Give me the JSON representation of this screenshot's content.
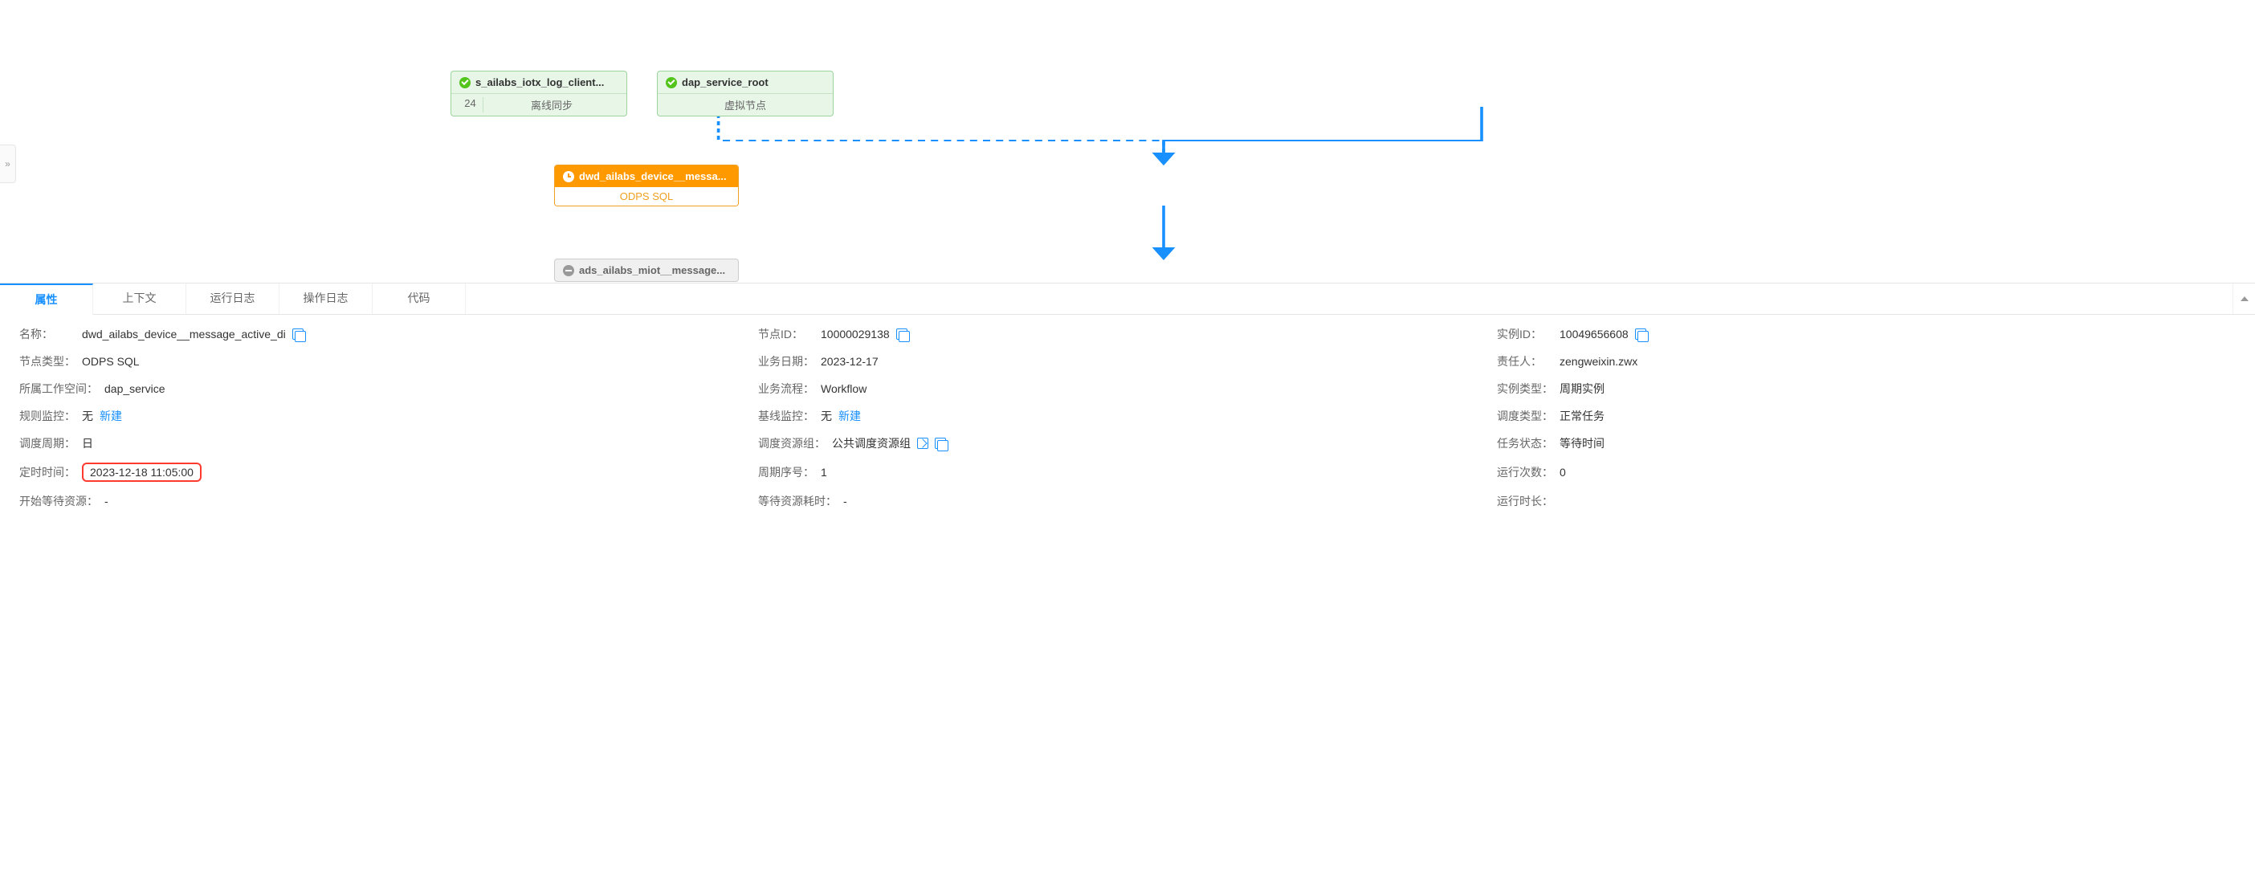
{
  "expander_glyph": "»",
  "graph": {
    "nodes": {
      "n1": {
        "title": "s_ailabs_iotx_log_client...",
        "count": "24",
        "subtype": "离线同步"
      },
      "n2": {
        "title": "dap_service_root",
        "subtype": "虚拟节点"
      },
      "n3": {
        "title": "dwd_ailabs_device__messa...",
        "subtype": "ODPS SQL"
      },
      "n4": {
        "title": "ads_ailabs_miot__message..."
      }
    }
  },
  "tabs": [
    {
      "id": "props",
      "label": "属性",
      "active": true
    },
    {
      "id": "context",
      "label": "上下文",
      "active": false
    },
    {
      "id": "runlog",
      "label": "运行日志",
      "active": false
    },
    {
      "id": "oplog",
      "label": "操作日志",
      "active": false
    },
    {
      "id": "code",
      "label": "代码",
      "active": false
    }
  ],
  "props": {
    "col1": [
      {
        "label": "名称",
        "value": "dwd_ailabs_device__message_active_di",
        "copy": true
      },
      {
        "label": "节点类型",
        "value": "ODPS SQL"
      },
      {
        "label": "所属工作空间",
        "value": "dap_service"
      },
      {
        "label": "规则监控",
        "value": "无",
        "link": "新建"
      },
      {
        "label": "调度周期",
        "value": "日"
      },
      {
        "label": "定时时间",
        "value": "2023-12-18 11:05:00",
        "highlight": true
      },
      {
        "label": "开始等待资源",
        "value": "-"
      }
    ],
    "col2": [
      {
        "label": "节点ID",
        "value": "10000029138",
        "copy": true
      },
      {
        "label": "业务日期",
        "value": "2023-12-17"
      },
      {
        "label": "业务流程",
        "value": "Workflow"
      },
      {
        "label": "基线监控",
        "value": "无",
        "link": "新建"
      },
      {
        "label": "调度资源组",
        "value": "公共调度资源组",
        "edit": true,
        "copy": true
      },
      {
        "label": "周期序号",
        "value": "1"
      },
      {
        "label": "等待资源耗时",
        "value": "-"
      }
    ],
    "col3": [
      {
        "label": "实例ID",
        "value": "10049656608",
        "copy": true
      },
      {
        "label": "责任人",
        "value": "zengweixin.zwx"
      },
      {
        "label": "实例类型",
        "value": "周期实例"
      },
      {
        "label": "调度类型",
        "value": "正常任务"
      },
      {
        "label": "任务状态",
        "value": "等待时间"
      },
      {
        "label": "运行次数",
        "value": "0"
      },
      {
        "label": "运行时长",
        "value": ""
      }
    ]
  }
}
